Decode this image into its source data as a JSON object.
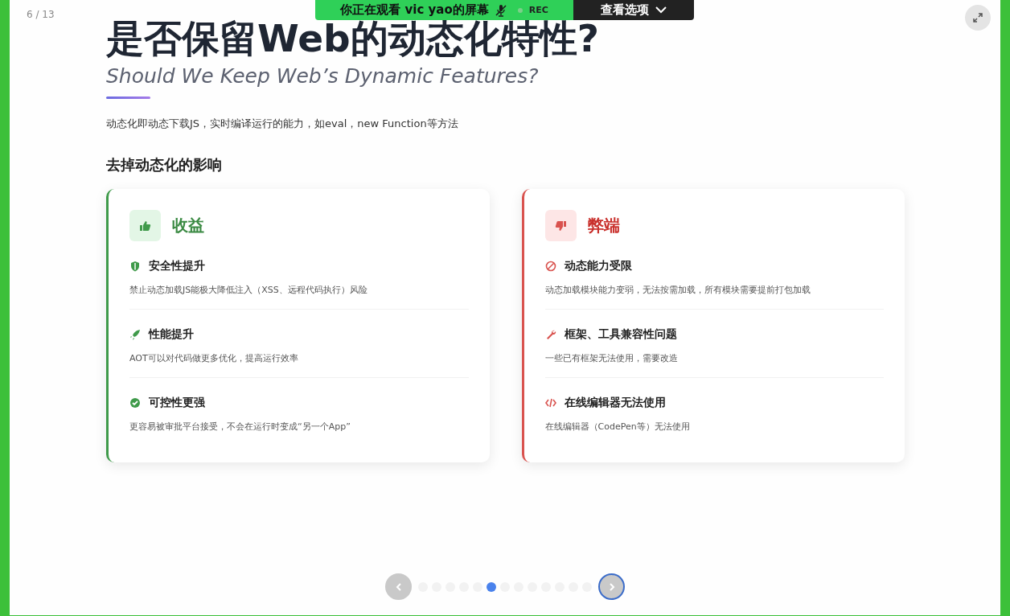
{
  "share_banner": {
    "viewing": "你正在观看 vic yao的屏幕",
    "rec": "REC",
    "options": "查看选项"
  },
  "slide_counter": "6 / 13",
  "slide": {
    "title": "是否保留Web的动态化特性?",
    "subtitle": "Should We Keep Web’s Dynamic Features?",
    "description": "动态化即动态下载JS，实时编译运行的能力，如eval，new Function等方法",
    "section_heading": "去掉动态化的影响",
    "cards": [
      {
        "kind": "pro",
        "title": "收益",
        "items": [
          {
            "title": "安全性提升",
            "text": "禁止动态加载JS能极大降低注入（XSS、远程代码执行）风险"
          },
          {
            "title": "性能提升",
            "text": "AOT可以对代码做更多优化，提高运行效率"
          },
          {
            "title": "可控性更强",
            "text": "更容易被审批平台接受，不会在运行时变成“另一个App”"
          }
        ]
      },
      {
        "kind": "con",
        "title": "弊端",
        "items": [
          {
            "title": "动态能力受限",
            "text": "动态加载模块能力变弱，无法按需加载，所有模块需要提前打包加载"
          },
          {
            "title": "框架、工具兼容性问题",
            "text": "一些已有框架无法使用，需要改造"
          },
          {
            "title": "在线编辑器无法使用",
            "text": "在线编辑器（CodePen等）无法使用"
          }
        ]
      }
    ]
  },
  "pagination": {
    "prev": {
      "focused": false
    },
    "next": {
      "focused": true
    },
    "dots": [
      {
        "selected": false
      },
      {
        "selected": false
      },
      {
        "selected": false
      },
      {
        "selected": false
      },
      {
        "selected": false
      },
      {
        "selected": true
      },
      {
        "selected": false
      },
      {
        "selected": false
      },
      {
        "selected": false
      },
      {
        "selected": false
      },
      {
        "selected": false
      },
      {
        "selected": false
      },
      {
        "selected": false
      }
    ]
  }
}
